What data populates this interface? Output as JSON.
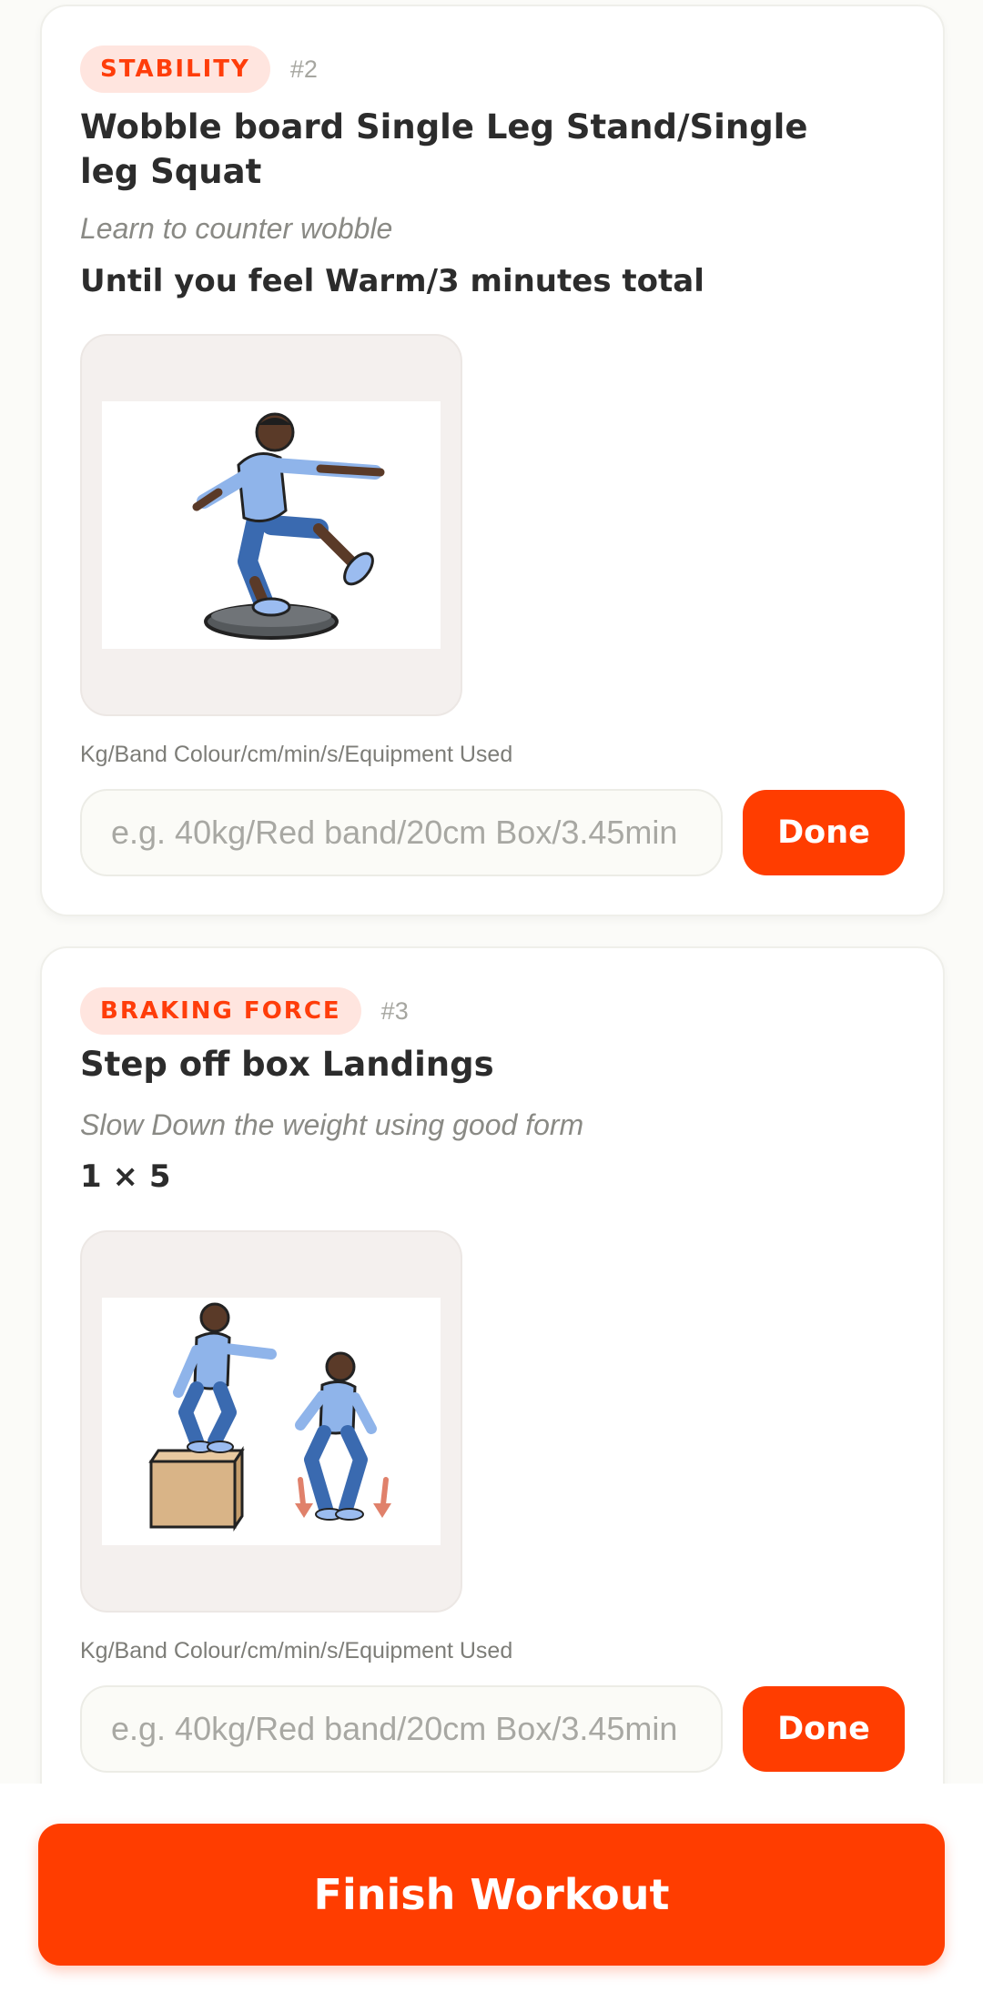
{
  "exercises": [
    {
      "category": "STABILITY",
      "number": "#2",
      "title": "Wobble board Single Leg Stand/Single leg Squat",
      "subtitle": "Learn to counter wobble",
      "dose": "Until you feel Warm/3 minutes total",
      "image_icon": "wobble-board-illustration",
      "field_label": "Kg/Band Colour/cm/min/s/Equipment Used",
      "field_placeholder": "e.g. 40kg/Red band/20cm Box/3.45min",
      "done_label": "Done"
    },
    {
      "category": "BRAKING FORCE",
      "number": "#3",
      "title": "Step off box Landings",
      "subtitle": "Slow Down the weight using good form",
      "dose": "1 × 5",
      "image_icon": "box-landing-illustration",
      "field_label": "Kg/Band Colour/cm/min/s/Equipment Used",
      "field_placeholder": "e.g. 40kg/Red band/20cm Box/3.45min",
      "done_label": "Done"
    }
  ],
  "footer": {
    "finish_label": "Finish Workout"
  },
  "colors": {
    "accent": "#ff3d00",
    "tag_bg": "#ffe5df",
    "page_bg": "#fbfbf8"
  }
}
